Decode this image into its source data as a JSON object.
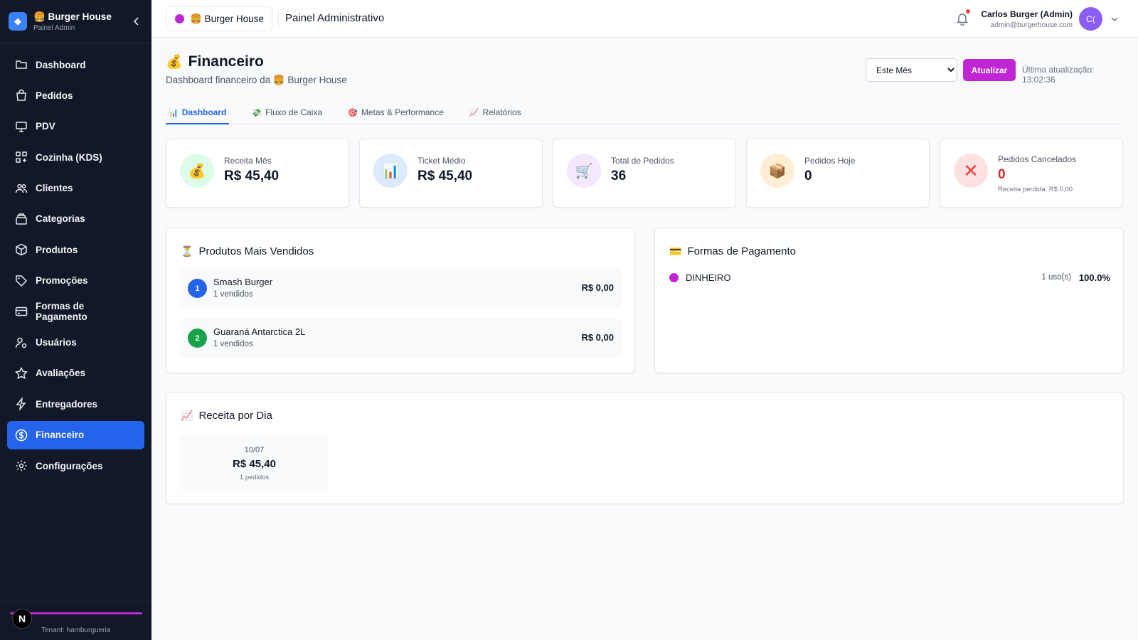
{
  "sidebar": {
    "brand_name": "🍔 Burger House",
    "brand_sub": "Painel Admin",
    "items": [
      {
        "label": "Dashboard",
        "icon": "folder-icon"
      },
      {
        "label": "Pedidos",
        "icon": "shopping-bag-icon"
      },
      {
        "label": "PDV",
        "icon": "monitor-icon"
      },
      {
        "label": "Cozinha (KDS)",
        "icon": "grid-icon"
      },
      {
        "label": "Clientes",
        "icon": "users-icon"
      },
      {
        "label": "Categorias",
        "icon": "archive-icon"
      },
      {
        "label": "Produtos",
        "icon": "box-icon"
      },
      {
        "label": "Promoções",
        "icon": "tag-icon"
      },
      {
        "label": "Formas de Pagamento",
        "icon": "credit-card-icon"
      },
      {
        "label": "Usuários",
        "icon": "user-cog-icon"
      },
      {
        "label": "Avaliações",
        "icon": "star-icon"
      },
      {
        "label": "Entregadores",
        "icon": "bolt-icon"
      },
      {
        "label": "Financeiro",
        "icon": "dollar-icon",
        "active": true
      },
      {
        "label": "Configurações",
        "icon": "gear-icon"
      }
    ],
    "footer_badge": "N",
    "tenant": "Tenant: hamburgueria"
  },
  "topbar": {
    "store": "🍔 Burger House",
    "title": "Painel Administrativo",
    "user_name": "Carlos Burger (Admin)",
    "user_email": "admin@burgerhouse.com",
    "avatar": "C("
  },
  "page": {
    "title": "Financeiro",
    "title_emoji": "💰",
    "subtitle": "Dashboard financeiro da 🍔 Burger House",
    "period_selected": "Este Mês",
    "refresh_label": "Atualizar",
    "last_update": "Última atualização: 13:02:36"
  },
  "tabs": [
    {
      "icon": "📊",
      "label": "Dashboard",
      "active": true
    },
    {
      "icon": "💸",
      "label": "Fluxo de Caixa"
    },
    {
      "icon": "🎯",
      "label": "Metas & Performance"
    },
    {
      "icon": "📈",
      "label": "Relatórios"
    }
  ],
  "cards": [
    {
      "icon": "💰",
      "label": "Receita Mês",
      "value": "R$ 45,40",
      "bg": "#dcfce7"
    },
    {
      "icon": "📊",
      "label": "Ticket Médio",
      "value": "R$ 45,40",
      "bg": "#dbeafe"
    },
    {
      "icon": "🛒",
      "label": "Total de Pedidos",
      "value": "36",
      "bg": "#f3e8ff"
    },
    {
      "icon": "📦",
      "label": "Pedidos Hoje",
      "value": "0",
      "bg": "#ffedd5"
    },
    {
      "icon": "✕",
      "label": "Pedidos Cancelados",
      "value": "0",
      "sub": "Receita perdida: R$ 0,00",
      "bg": "#fee2e2"
    }
  ],
  "top_products": {
    "icon": "⏳",
    "title": "Produtos Mais Vendidos",
    "items": [
      {
        "rank": "1",
        "name": "Smash Burger",
        "sold": "1 vendidos",
        "price": "R$ 0,00",
        "color": "#2563eb"
      },
      {
        "rank": "2",
        "name": "Guaraná Antarctica 2L",
        "sold": "1 vendidos",
        "price": "R$ 0,00",
        "color": "#16a34a"
      }
    ]
  },
  "payments": {
    "icon": "💳",
    "title": "Formas de Pagamento",
    "items": [
      {
        "name": "DINHEIRO",
        "uses": "1 uso(s)",
        "pct": "100.0%",
        "color": "#c026d3"
      }
    ]
  },
  "revenue_by_day": {
    "icon": "📈",
    "title": "Receita por Dia",
    "days": [
      {
        "date": "10/07",
        "value": "R$ 45,40",
        "orders": "1 pedidos"
      }
    ]
  }
}
